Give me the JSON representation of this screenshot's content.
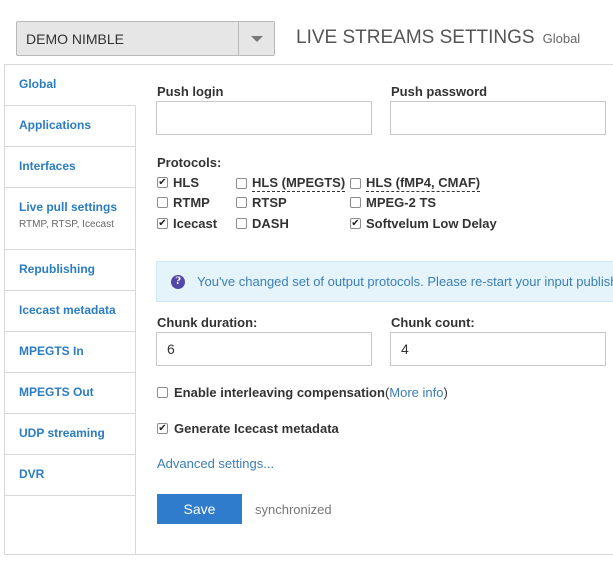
{
  "header": {
    "server_select": "DEMO NIMBLE",
    "title": "LIVE STREAMS SETTINGS",
    "scope": "Global"
  },
  "sidebar": {
    "items": [
      {
        "label": "Global",
        "sub": ""
      },
      {
        "label": "Applications",
        "sub": ""
      },
      {
        "label": "Interfaces",
        "sub": ""
      },
      {
        "label": "Live pull settings",
        "sub": "RTMP, RTSP, Icecast"
      },
      {
        "label": "Republishing",
        "sub": ""
      },
      {
        "label": "Icecast metadata",
        "sub": ""
      },
      {
        "label": "MPEGTS In",
        "sub": ""
      },
      {
        "label": "MPEGTS Out",
        "sub": ""
      },
      {
        "label": "UDP streaming",
        "sub": ""
      },
      {
        "label": "DVR",
        "sub": ""
      }
    ]
  },
  "form": {
    "push_login": {
      "label": "Push login",
      "value": ""
    },
    "push_password": {
      "label": "Push password",
      "value": ""
    },
    "protocols_label": "Protocols:",
    "protocols": [
      {
        "label": "HLS",
        "checked": true
      },
      {
        "label": "HLS (MPEGTS)",
        "checked": false
      },
      {
        "label": "HLS (fMP4, CMAF)",
        "checked": false
      },
      {
        "label": "RTMP",
        "checked": false
      },
      {
        "label": "RTSP",
        "checked": false
      },
      {
        "label": "MPEG-2 TS",
        "checked": false
      },
      {
        "label": "Icecast",
        "checked": true
      },
      {
        "label": "DASH",
        "checked": false
      },
      {
        "label": "Softvelum Low Delay",
        "checked": true
      }
    ],
    "notice": "You've changed set of output protocols. Please re-start your input publisher",
    "chunk_duration": {
      "label": "Chunk duration:",
      "value": "6"
    },
    "chunk_count": {
      "label": "Chunk count:",
      "value": "4"
    },
    "interleaving": {
      "label": "Enable interleaving compensation",
      "checked": false,
      "link": "More info",
      "open": " (",
      "close": ")"
    },
    "icecast_metadata": {
      "label": "Generate Icecast metadata",
      "checked": true
    },
    "advanced_link": "Advanced settings...",
    "save_label": "Save",
    "sync_status": "synchronized"
  }
}
